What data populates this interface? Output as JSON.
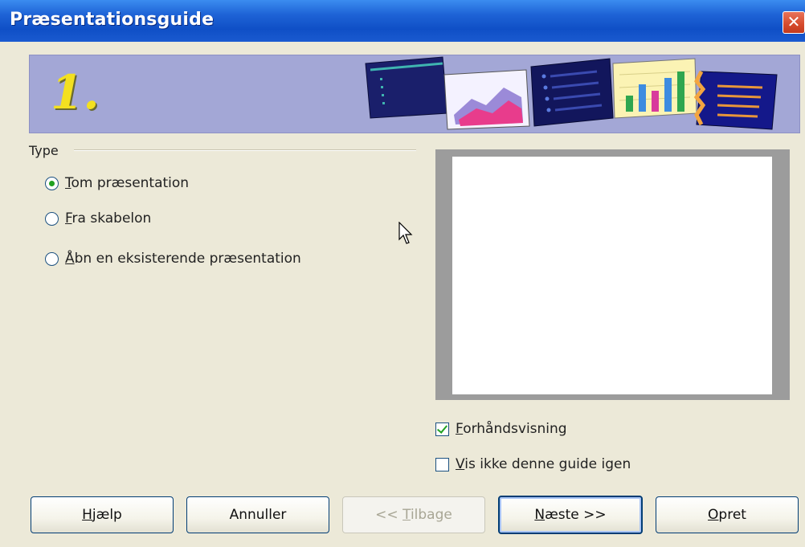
{
  "window": {
    "title": "Præsentationsguide",
    "close_glyph": "✕"
  },
  "banner": {
    "step_number": "1.",
    "bg_color": "#A3A7D6",
    "number_color": "#F3E020"
  },
  "type_group": {
    "label": "Type",
    "options": [
      {
        "mnemonic": "T",
        "rest": "om præsentation",
        "selected": true
      },
      {
        "mnemonic": "F",
        "rest": "ra skabelon",
        "selected": false
      },
      {
        "mnemonic": "Å",
        "rest": "bn en eksisterende præsentation",
        "selected": false
      }
    ]
  },
  "checkboxes": {
    "preview": {
      "mnemonic": "F",
      "rest": "orhåndsvisning",
      "checked": true
    },
    "dont_show": {
      "mnemonic": "V",
      "rest": "is ikke denne guide igen",
      "checked": false
    }
  },
  "buttons": {
    "help": {
      "mnemonic": "H",
      "rest": "jælp"
    },
    "cancel": {
      "label": "Annuller"
    },
    "back": {
      "prefix": "<< ",
      "mnemonic": "T",
      "rest": "ilbage",
      "enabled": false
    },
    "next": {
      "mnemonic": "N",
      "rest": "æste >>"
    },
    "create": {
      "mnemonic": "O",
      "rest": "pret"
    }
  },
  "icons": [
    "close-icon",
    "slide-list-icon",
    "area-chart-icon",
    "bullet-slide-icon",
    "bar-chart-icon",
    "text-slide-icon",
    "mouse-cursor-icon"
  ],
  "colors": {
    "titlebar": "#1E63D6",
    "dialog_bg": "#ECE9D8",
    "radio_dot": "#21A121",
    "button_border": "#003C74"
  }
}
